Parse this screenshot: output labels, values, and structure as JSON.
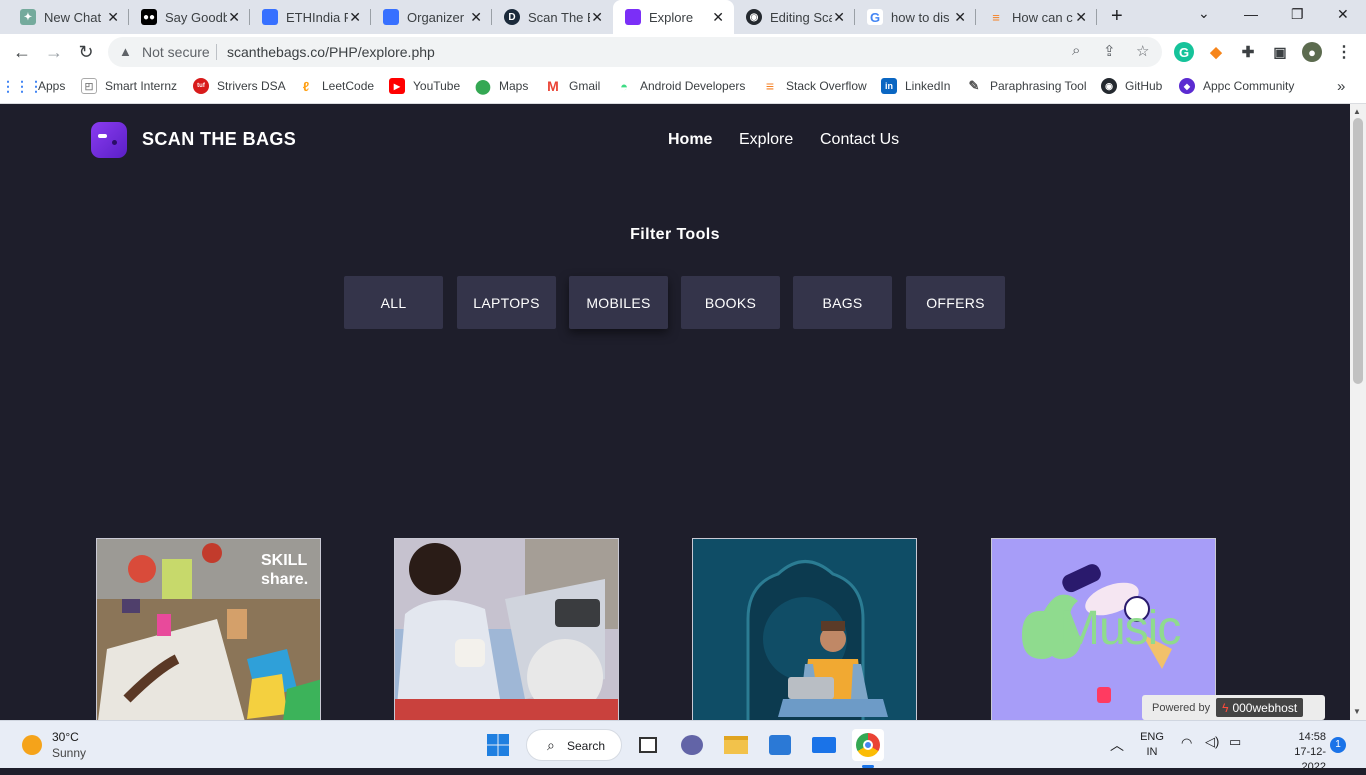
{
  "browser": {
    "tabs": [
      {
        "title": "New Chat",
        "icon": "chatgpt-icon",
        "color": "#74aa9c"
      },
      {
        "title": "Say Goodb",
        "icon": "medium-icon",
        "color": "#000000"
      },
      {
        "title": "ETHIndia F",
        "icon": "devfolio-icon",
        "color": "#3770ff"
      },
      {
        "title": "Organizer",
        "icon": "devfolio-icon",
        "color": "#3770ff"
      },
      {
        "title": "Scan The E",
        "icon": "dev-icon",
        "color": "#1b2a3a"
      },
      {
        "title": "Explore",
        "icon": "scanthebags-icon",
        "color": "#7b2ff7"
      },
      {
        "title": "Editing Sca",
        "icon": "github-icon",
        "color": "#24292f"
      },
      {
        "title": "how to dis",
        "icon": "google-icon",
        "color": "#4285f4"
      },
      {
        "title": "How can c",
        "icon": "stackoverflow-icon",
        "color": "#f48024"
      }
    ],
    "address": {
      "security_label": "Not secure",
      "url": "scanthebags.co/PHP/explore.php"
    },
    "bookmarks": [
      {
        "label": "Apps",
        "icon": "apps-grid-icon",
        "color": "#4285f4"
      },
      {
        "label": "Smart Internz",
        "icon": "smartinternz-icon",
        "color": "#7a7a7a"
      },
      {
        "label": "Strivers DSA",
        "icon": "tuf-icon",
        "color": "#d81b1b"
      },
      {
        "label": "LeetCode",
        "icon": "leetcode-icon",
        "color": "#ffa116"
      },
      {
        "label": "YouTube",
        "icon": "youtube-icon",
        "color": "#ff0000"
      },
      {
        "label": "Maps",
        "icon": "maps-icon",
        "color": "#34a853"
      },
      {
        "label": "Gmail",
        "icon": "gmail-icon",
        "color": "#ea4335"
      },
      {
        "label": "Android Developers",
        "icon": "android-icon",
        "color": "#3ddc84"
      },
      {
        "label": "Stack Overflow",
        "icon": "stackoverflow-icon",
        "color": "#f48024"
      },
      {
        "label": "LinkedIn",
        "icon": "linkedin-icon",
        "color": "#0a66c2"
      },
      {
        "label": "Paraphrasing Tool",
        "icon": "feather-icon",
        "color": "#555555"
      },
      {
        "label": "GitHub",
        "icon": "github-icon",
        "color": "#24292f"
      },
      {
        "label": "Appc Community",
        "icon": "appc-icon",
        "color": "#5b2bd1"
      }
    ]
  },
  "site": {
    "brand": "SCAN THE BAGS",
    "nav": [
      "Home",
      "Explore",
      "Contact Us"
    ],
    "filter_title": "Filter Tools",
    "filters": [
      "ALL",
      "LAPTOPS",
      "MOBILES",
      "BOOKS",
      "BAGS",
      "OFFERS"
    ],
    "cards": [
      {
        "name": "skillshare-card",
        "logo_text": "SKILL share."
      },
      {
        "name": "laptop-person-card"
      },
      {
        "name": "laptop-sitting-card"
      },
      {
        "name": "apple-music-card",
        "logo_text": "Music"
      }
    ],
    "powered_by": "Powered by",
    "host": "000webhost"
  },
  "taskbar": {
    "weather_temp": "30°C",
    "weather_desc": "Sunny",
    "search_label": "Search",
    "lang": "ENG",
    "region": "IN",
    "time": "14:58",
    "date": "17-12-2022",
    "notifications": "1"
  }
}
